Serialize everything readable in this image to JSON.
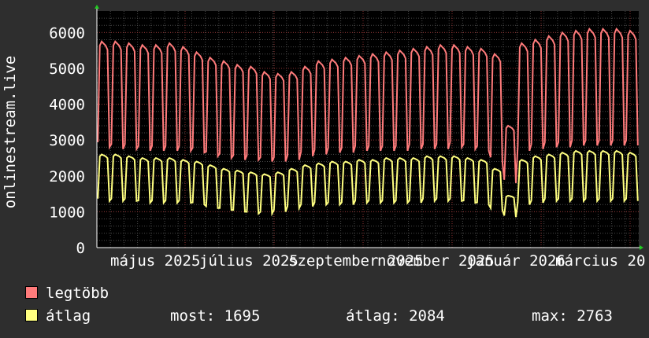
{
  "chart_data": {
    "type": "line",
    "ylabel": "onlinestream.live",
    "ylim": [
      0,
      6600
    ],
    "y_ticks": [
      0,
      1000,
      2000,
      3000,
      4000,
      5000,
      6000
    ],
    "x_tick_labels": [
      "május 2025",
      "július 2025",
      "szeptember 2025",
      "november 2025",
      "január 2026",
      "március 20"
    ],
    "grid": true,
    "legend_position": "bottom-left",
    "series": [
      {
        "name": "legtöbb",
        "color": "#ff7b7b",
        "weekly_pattern_note_free": true,
        "weekday_peak_values": [
          5750,
          5750,
          5700,
          5650,
          5650,
          5700,
          5600,
          5450,
          5300,
          5200,
          5100,
          5050,
          4900,
          4850,
          4900,
          5050,
          5200,
          5250,
          5300,
          5350,
          5400,
          5450,
          5500,
          5550,
          5600,
          5650,
          5650,
          5600,
          5550,
          5400,
          3400,
          5700,
          5800,
          5900,
          6000,
          6050,
          6100,
          6100,
          6100,
          6050
        ],
        "weekend_low_values": [
          2800,
          2750,
          2750,
          2700,
          2700,
          2700,
          2700,
          2650,
          2550,
          2500,
          2450,
          2450,
          2400,
          2400,
          2450,
          2550,
          2600,
          2650,
          2650,
          2700,
          2700,
          2700,
          2700,
          2750,
          2750,
          2750,
          2800,
          2750,
          2700,
          2400,
          1800,
          2700,
          2750,
          2800,
          2800,
          2850,
          2850,
          2850,
          2850,
          2850
        ]
      },
      {
        "name": "átlag",
        "color": "#ffff80",
        "weekday_peak_values": [
          2600,
          2600,
          2550,
          2500,
          2500,
          2500,
          2450,
          2400,
          2300,
          2200,
          2150,
          2100,
          2050,
          2100,
          2200,
          2300,
          2350,
          2400,
          2400,
          2450,
          2450,
          2500,
          2500,
          2500,
          2550,
          2550,
          2550,
          2500,
          2450,
          2200,
          1450,
          2450,
          2550,
          2600,
          2650,
          2700,
          2700,
          2700,
          2700,
          2650
        ],
        "weekend_low_values": [
          1300,
          1300,
          1300,
          1250,
          1250,
          1250,
          1250,
          1200,
          1100,
          1050,
          1000,
          950,
          950,
          1000,
          1100,
          1150,
          1200,
          1200,
          1200,
          1250,
          1250,
          1250,
          1250,
          1250,
          1300,
          1300,
          1300,
          1250,
          1200,
          1050,
          850,
          1200,
          1250,
          1300,
          1300,
          1300,
          1300,
          1300,
          1300,
          1300
        ]
      }
    ]
  },
  "legend": {
    "max_label": "legtöbb",
    "avg_label": "átlag",
    "max_color": "#ff7b7b",
    "avg_color": "#ffff80"
  },
  "stats": {
    "now": "most: 1695",
    "avg": "átlag: 2084",
    "max": "max: 2763"
  }
}
